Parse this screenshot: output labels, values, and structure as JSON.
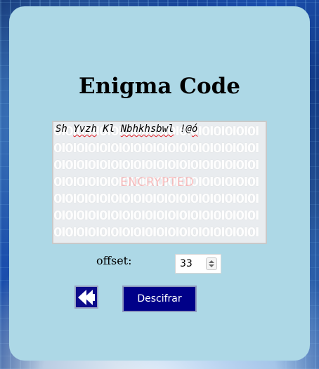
{
  "app": {
    "title": "Enigma Code"
  },
  "message": {
    "text_parts": [
      "Sh ",
      "Yvzh",
      " Kl ",
      "Nbhkhsbwl",
      " !@",
      "ó"
    ],
    "background_watermark": "ENCRYPTED"
  },
  "offset": {
    "label": "offset:",
    "value": "33"
  },
  "buttons": {
    "decrypt_label": "Descifrar",
    "back_icon": "double-left-arrow-icon"
  },
  "colors": {
    "panel": "#add8e6",
    "button_bg": "#000088",
    "button_text": "#ffffff"
  }
}
